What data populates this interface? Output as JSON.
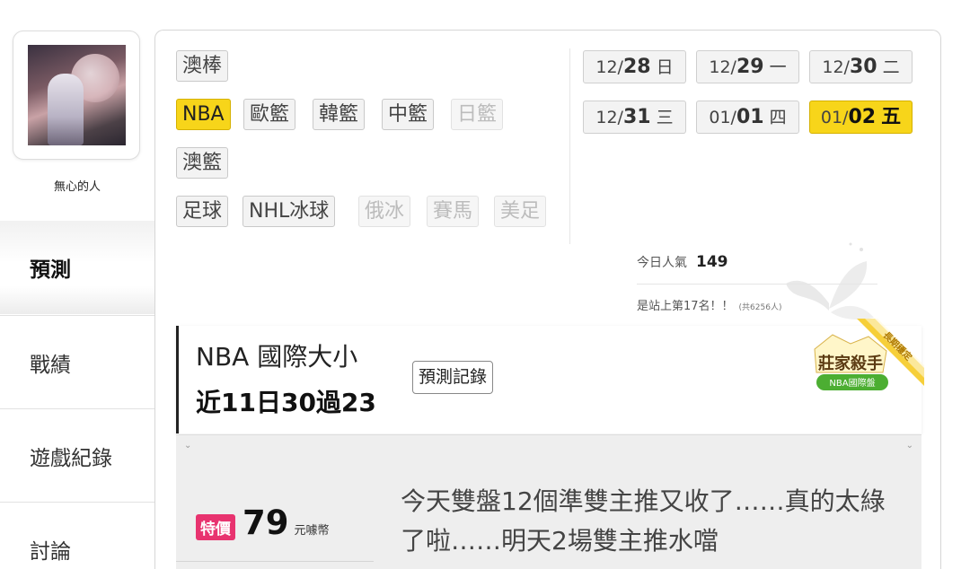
{
  "profile": {
    "username": "無心的人"
  },
  "nav": [
    {
      "label": "預測",
      "active": true
    },
    {
      "label": "戰績",
      "active": false
    },
    {
      "label": "遊戲紀錄",
      "active": false
    },
    {
      "label": "討論",
      "active": false
    }
  ],
  "sports": {
    "row1": [
      {
        "label": "澳棒",
        "state": "normal"
      }
    ],
    "row2": [
      {
        "label": "NBA",
        "state": "selected"
      },
      {
        "label": "歐籃",
        "state": "normal"
      },
      {
        "label": "韓籃",
        "state": "normal"
      },
      {
        "label": "中籃",
        "state": "normal"
      },
      {
        "label": "日籃",
        "state": "disabled"
      }
    ],
    "row3": [
      {
        "label": "澳籃",
        "state": "normal"
      }
    ],
    "row4": [
      {
        "label": "足球",
        "state": "normal"
      },
      {
        "label": "NHL冰球",
        "state": "normal"
      },
      {
        "label": "俄冰",
        "state": "disabled"
      },
      {
        "label": "賽馬",
        "state": "disabled"
      },
      {
        "label": "美足",
        "state": "disabled"
      }
    ]
  },
  "dates": [
    {
      "month": "12/",
      "day": "28",
      "weekday": "日",
      "selected": false
    },
    {
      "month": "12/",
      "day": "29",
      "weekday": "一",
      "selected": false
    },
    {
      "month": "12/",
      "day": "30",
      "weekday": "二",
      "selected": false
    },
    {
      "month": "12/",
      "day": "31",
      "weekday": "三",
      "selected": false
    },
    {
      "month": "01/",
      "day": "01",
      "weekday": "四",
      "selected": false
    },
    {
      "month": "01/",
      "day": "02",
      "weekday": "五",
      "selected": true
    }
  ],
  "popularity": {
    "label": "今日人氣",
    "value": "149",
    "rank_text": "是站上第17名！！",
    "total_text": "(共6256人)"
  },
  "prediction": {
    "title": "NBA 國際大小",
    "record": "近11日30過23",
    "record_button": "預測記錄",
    "badge_title": "莊家殺手",
    "badge_sub": "NBA國際盤",
    "badge_ribbon": "長期穩定"
  },
  "offer": {
    "special_label": "特價",
    "price": "79",
    "unit": "元噱幣",
    "description": "今天雙盤12個準雙主推又收了……真的太綠了啦……明天2場雙主推水噹"
  },
  "colors": {
    "selected": "#f7d51a",
    "special": "#e8336f",
    "badge_green": "#4cae32"
  }
}
